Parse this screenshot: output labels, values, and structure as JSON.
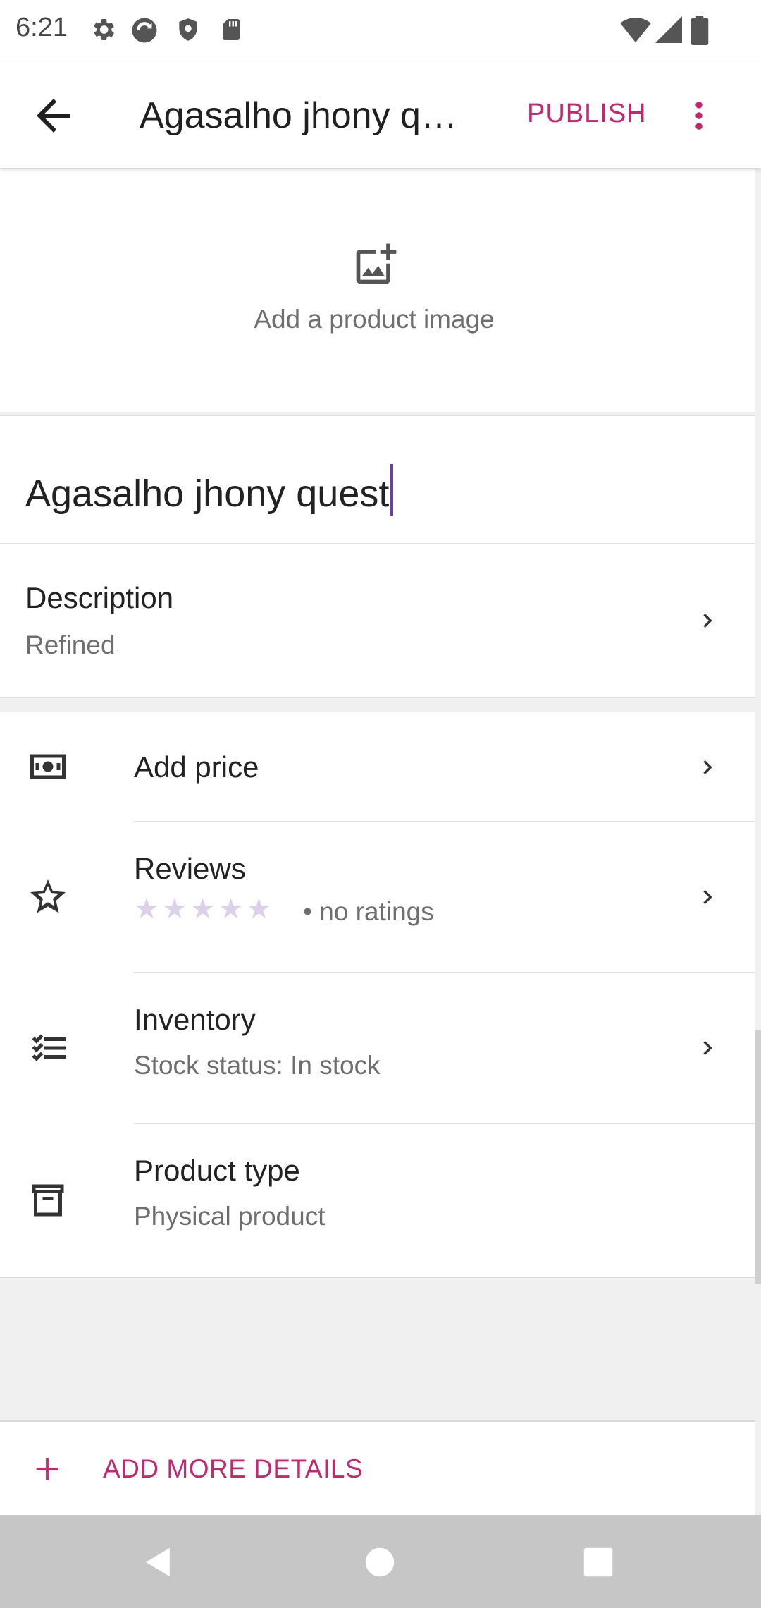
{
  "status_bar": {
    "time": "6:21"
  },
  "app_bar": {
    "title": "Agasalho jhony q…",
    "publish_label": "PUBLISH"
  },
  "image_area": {
    "label": "Add a product image"
  },
  "product": {
    "name": "Agasalho jhony quest"
  },
  "description": {
    "title": "Description",
    "value": "Refined"
  },
  "rows": {
    "price": {
      "title": "Add price"
    },
    "reviews": {
      "title": "Reviews",
      "stars": "★★★★★",
      "rating_text": "• no ratings"
    },
    "inventory": {
      "title": "Inventory",
      "value": "Stock status: In stock"
    },
    "product_type": {
      "title": "Product type",
      "value": "Physical product"
    }
  },
  "footer": {
    "add_more_label": "ADD MORE DETAILS"
  },
  "colors": {
    "accent": "#c8256f",
    "cursor": "#6a3fa0",
    "star_empty": "#dcd0ea"
  }
}
